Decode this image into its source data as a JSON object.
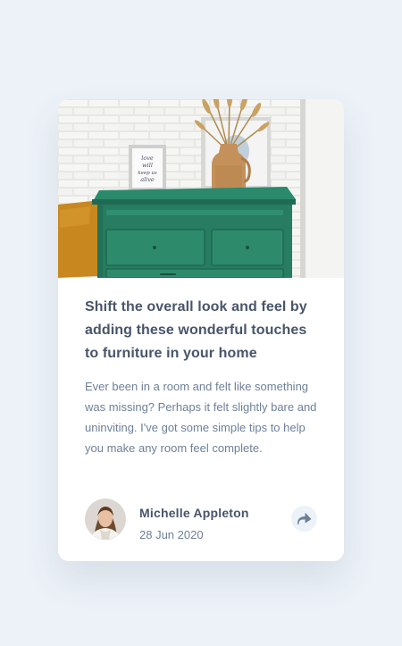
{
  "article": {
    "title": "Shift the overall look and feel by adding these wonderful touches to furniture in your home",
    "excerpt": "Ever been in a room and felt like something was missing? Perhaps it felt slightly bare and uninviting. I've got some simple tips to help you make any room feel complete."
  },
  "author": {
    "name": "Michelle Appleton",
    "date": "28 Jun 2020"
  },
  "frame_text": "love will keep us alive",
  "icons": {
    "share": "share-icon"
  },
  "colors": {
    "page_background": "#ecf2f8",
    "heading": "#48556a",
    "body_text": "#6e8098",
    "share_bg": "#ecf2f8",
    "share_icon": "#6e8098"
  }
}
